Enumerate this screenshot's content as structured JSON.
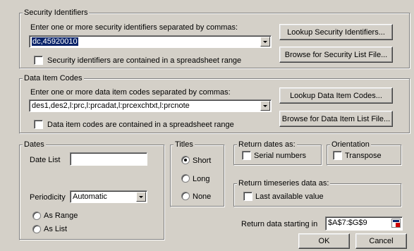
{
  "security": {
    "legend": "Security Identifiers",
    "prompt": "Enter one or more security identifiers separated by commas:",
    "value": "dc,45920010",
    "checkbox_label": "Security identifiers are contained in a spreadsheet range",
    "lookup_button": "Lookup Security Identifiers...",
    "browse_button": "Browse for Security List File..."
  },
  "data_items": {
    "legend": "Data Item Codes",
    "prompt": "Enter one or more data item codes separated by commas:",
    "value": "des1,des2,l:prc,l:prcadat,l:prcexchtxt,l:prcnote",
    "checkbox_label": "Data item codes are contained in a spreadsheet range",
    "lookup_button": "Lookup Data Item Codes...",
    "browse_button": "Browse for Data Item List File..."
  },
  "dates": {
    "legend": "Dates",
    "date_list_label": "Date List",
    "date_list_value": "",
    "periodicity_label": "Periodicity",
    "periodicity_value": "Automatic",
    "as_range_label": "As Range",
    "as_list_label": "As List"
  },
  "titles": {
    "legend": "Titles",
    "short_label": "Short",
    "long_label": "Long",
    "none_label": "None",
    "selected": "Short"
  },
  "return_dates": {
    "legend": "Return dates as:",
    "serial_label": "Serial numbers"
  },
  "orientation": {
    "legend": "Orientation",
    "transpose_label": "Transpose"
  },
  "timeseries": {
    "legend": "Return timeseries data as:",
    "last_label": "Last available value"
  },
  "starting": {
    "label": "Return data starting in",
    "value": "$A$7:$G$9"
  },
  "buttons": {
    "ok": "OK",
    "cancel": "Cancel"
  }
}
